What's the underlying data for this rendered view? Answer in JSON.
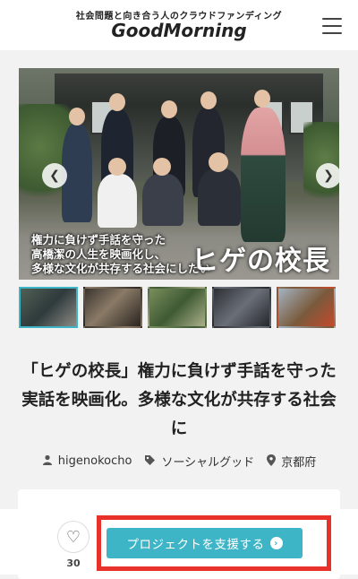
{
  "header": {
    "tagline": "社会問題と向き合う人のクラウドファンディング",
    "logo": "GoodMorning",
    "menu_icon": "hamburger-menu-icon"
  },
  "hero": {
    "caption_lines": [
      "権力に負けず手話を守った",
      "高橋潔の人生を映画化し、",
      "多様な文化が共存する社会にしたい"
    ],
    "badge": "ヒゲの校長",
    "prev_icon": "chevron-left-icon",
    "next_icon": "chevron-right-icon",
    "prev_glyph": "❮",
    "next_glyph": "❯"
  },
  "thumbnails": {
    "count": 5,
    "active_index": 0
  },
  "project": {
    "title": "「ヒゲの校長」権力に負けず手話を守った実話を映画化。多様な文化が共存する社会に",
    "author": "higenokocho",
    "category": "ソーシャルグッド",
    "location": "京都府"
  },
  "footer": {
    "like_count": "30",
    "support_label": "プロジェクトを支援する",
    "heart_glyph": "♡",
    "chevron_glyph": "›"
  },
  "colors": {
    "accent": "#3db5c7",
    "highlight_box": "#e8312b"
  }
}
